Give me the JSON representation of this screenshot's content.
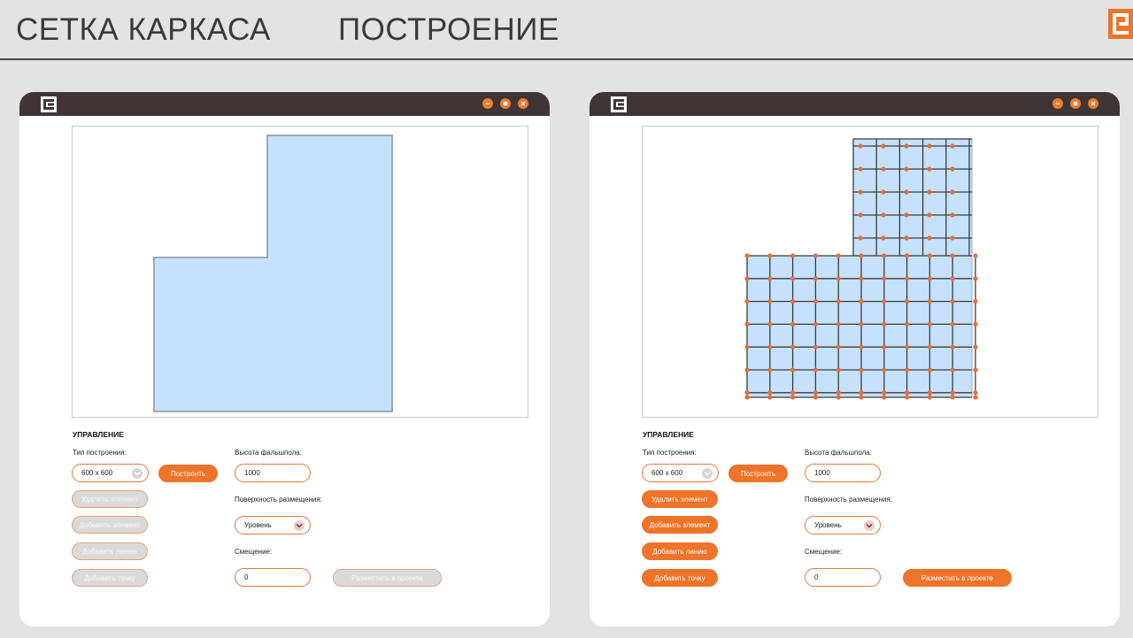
{
  "header": {
    "title_left": "СЕТКА КАРКАСА",
    "title_right": "ПОСТРОЕНИЕ"
  },
  "colors": {
    "accent": "#ef7328",
    "titlebar": "#3f3535",
    "fill_shape": "#c5e1fb",
    "grid_node": "#e2703a"
  },
  "icons": {
    "brand": "brand-logo-icon",
    "minimize": "minimize-icon",
    "maximize": "maximize-icon",
    "close": "close-icon",
    "dropdown": "chevron-down-icon"
  },
  "windows": [
    {
      "state": "before",
      "controls_title": "УПРАВЛЕНИЕ",
      "build_type_label": "Тип построения:",
      "build_type_value": "600 x 600",
      "build_button": "Построить",
      "delete_element": "Удалить элемент",
      "add_element": "Добавить элемент",
      "add_line": "Добавить линию",
      "add_point": "Добавить точку",
      "height_label": "Высота фальшпола:",
      "height_value": "1000",
      "surface_label": "Поверхность размещения:",
      "surface_value": "Уровень",
      "offset_label": "Смещение:",
      "offset_value": "0",
      "place_button": "Разместить в проекте"
    },
    {
      "state": "after",
      "controls_title": "УПРАВЛЕНИЕ",
      "build_type_label": "Тип построения:",
      "build_type_value": "600 x 600",
      "build_button": "Построить",
      "delete_element": "Удалить элемент",
      "add_element": "Добавить элемент",
      "add_line": "Добавить линию",
      "add_point": "Добавить точку",
      "height_label": "Высота фальшпола:",
      "height_value": "1000",
      "surface_label": "Поверхность размещения:",
      "surface_value": "Уровень",
      "offset_label": "Смещение:",
      "offset_value": "0",
      "place_button": "Разместить в проекте"
    }
  ]
}
